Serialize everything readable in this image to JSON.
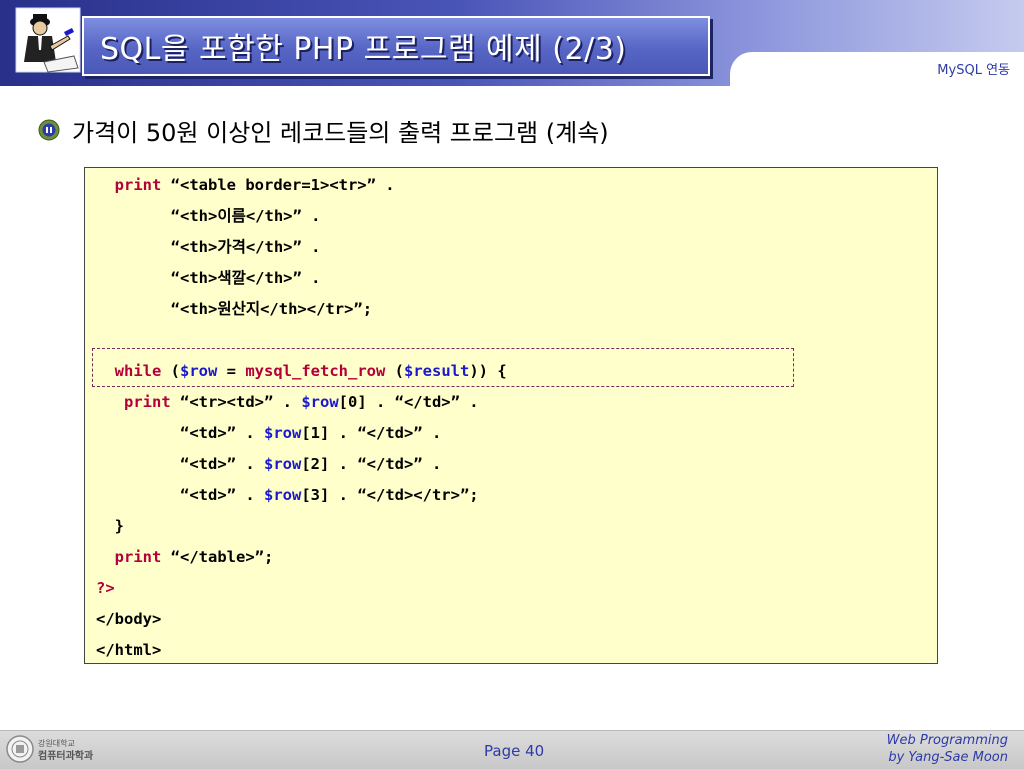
{
  "header": {
    "title": "SQL을 포함한 PHP 프로그램 예제 (2/3)",
    "subtitle": "MySQL 연동"
  },
  "content": {
    "heading": "가격이 50원 이상인 레코드들의 출력 프로그램 (계속)"
  },
  "code": {
    "line1": {
      "kw": "print",
      "rest": " “<table border=1><tr>” ."
    },
    "line2": "“<th>이름</th>” .",
    "line3": "“<th>가격</th>” .",
    "line4": "“<th>색깔</th>” .",
    "line5": "“<th>원산지</th></tr>”;",
    "line7": {
      "kw1": "while",
      "p1": " (",
      "v1": "$row",
      "p2": " = ",
      "kw2": "mysql_fetch_row",
      "p3": " (",
      "v2": "$result",
      "p4": ")) {"
    },
    "line8": {
      "kw": "print",
      "p1": " “<tr><td>” . ",
      "v": "$row",
      "p2": "[0] . “</td>” ."
    },
    "line9": {
      "p1": "“<td>” . ",
      "v": "$row",
      "p2": "[1] . “</td>” ."
    },
    "line10": {
      "p1": "“<td>” . ",
      "v": "$row",
      "p2": "[2] . “</td>” ."
    },
    "line11": {
      "p1": "“<td>” . ",
      "v": "$row",
      "p2": "[3] . “</td></tr>”;"
    },
    "line12": "}",
    "line13": {
      "kw": "print",
      "rest": " “</table>”;"
    },
    "line14": "?>",
    "line15": "</body>",
    "line16": "</html>"
  },
  "footer": {
    "page": "Page 40",
    "credit_line1": "Web Programming",
    "credit_line2": "by Yang-Sae Moon",
    "logo_text_line1": "강원대학교",
    "logo_text_line2": "컴퓨터과학과"
  },
  "colors": {
    "keyword": "#b3003b",
    "variable": "#1a1acc",
    "code_background": "#ffffcc",
    "title_text": "#ffffff",
    "accent_blue": "#2d3aa8"
  },
  "icons": {
    "header_logo": "man-with-pen-icon",
    "bullet": "emblem-bullet-icon",
    "footer_logo": "university-seal-icon"
  }
}
